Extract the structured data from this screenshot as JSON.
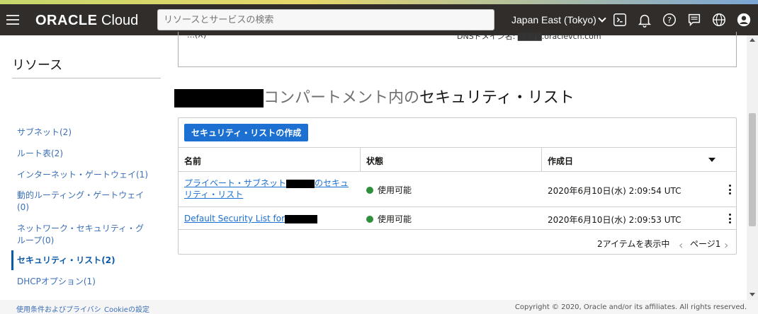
{
  "topbar": {
    "brand_bold": "ORACLE",
    "brand_light": "Cloud",
    "search_placeholder": "リソースとサービスの検索",
    "region": "Japan East (Tokyo)",
    "icons": [
      "menu-icon",
      "cloud-shell-icon",
      "bell-icon",
      "help-icon",
      "chat-icon",
      "globe-icon",
      "user-icon"
    ]
  },
  "overview": {
    "left_text": "…(X)",
    "right_text": "DNSドメイン名: ▇▇▇▇.oraclevcn.com"
  },
  "sidebar": {
    "title": "リソース",
    "items": [
      {
        "label": "サブネット(2)"
      },
      {
        "label": "ルート表(2)"
      },
      {
        "label": "インターネット・ゲートウェイ(1)"
      },
      {
        "label": "動的ルーティング・ゲートウェイ(0)"
      },
      {
        "label": "ネットワーク・セキュリティ・グループ(0)"
      },
      {
        "label": "セキュリティ・リスト(2)"
      },
      {
        "label": "DHCPオプション(1)"
      }
    ]
  },
  "main": {
    "heading_gray": "コンパートメント内の",
    "heading_dark": "セキュリティ・リスト",
    "create_button": "セキュリティ・リストの作成",
    "columns": [
      "名前",
      "状態",
      "作成日"
    ],
    "rows": [
      {
        "name_part1": "プライベート・サブネット",
        "name_part2": "のセキュ",
        "name_line2": "リティ・リスト",
        "status": "使用可能",
        "created": "2020年6月10日(水) 2:09:54 UTC"
      },
      {
        "name_part1": "Default Security List for",
        "status": "使用可能",
        "created": "2020年6月10日(水) 2:09:53 UTC"
      }
    ],
    "pager_count": "2アイテムを表示中",
    "pager_page": "ページ1"
  },
  "footer": {
    "terms": "使用条件およびプライバシ",
    "cookie": "Cookieの設定",
    "copyright": "Copyright © 2020, Oracle and/or its affiliates. All rights reserved."
  },
  "colors": {
    "topbar": "#312d2a",
    "accent": "#1b70d1",
    "status_ok": "#2f8f3a"
  }
}
